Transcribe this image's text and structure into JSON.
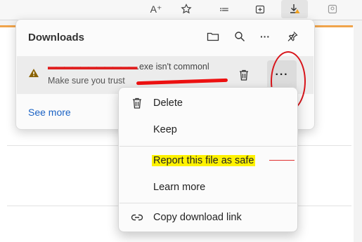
{
  "toolbar": {
    "buttons": [
      {
        "name": "read-aloud-button",
        "glyph": "A⁺"
      },
      {
        "name": "favorites-button",
        "glyph": "☆"
      },
      {
        "name": "favorites-bar-button",
        "glyph": "≔"
      },
      {
        "name": "collections-button",
        "glyph": "⊞"
      },
      {
        "name": "downloads-button",
        "glyph": "↓"
      },
      {
        "name": "profile-button",
        "glyph": "◫"
      }
    ]
  },
  "downloads": {
    "title": "Downloads",
    "item": {
      "filename_suffix": ".exe isn't commonl",
      "subtitle": "Make sure you trust ",
      "redacted_mark": "▬▬▬▬▬▬▬▬▬▬▬"
    },
    "more_label": "···",
    "see_more": "See more"
  },
  "menu": {
    "items": [
      {
        "label": "Delete",
        "icon": "trash-icon"
      },
      {
        "label": "Keep",
        "icon": ""
      },
      {
        "label": "Report this file as safe",
        "icon": ""
      },
      {
        "label": "Learn more",
        "icon": ""
      },
      {
        "label": "Copy download link",
        "icon": "link-icon"
      }
    ]
  },
  "annotation_colors": {
    "circle": "#d8141a",
    "highlight": "#fff200",
    "redaction": "#e02020"
  }
}
